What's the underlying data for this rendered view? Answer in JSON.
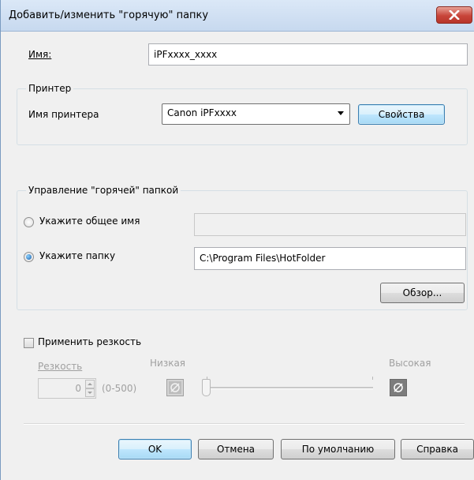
{
  "window": {
    "title": "Добавить/изменить \"горячую\" папку"
  },
  "name": {
    "label": "Имя:",
    "value": "iPFxxxx_xxxx"
  },
  "printer": {
    "group_label": "Принтер",
    "name_label": "Имя принтера",
    "selected": "Canon iPFxxxx",
    "properties_button": "Свойства"
  },
  "hotfolder": {
    "group_label": "Управление \"горячей\" папкой",
    "share_name_label": "Укажите общее имя",
    "share_name_value": "",
    "folder_label": "Укажите папку",
    "folder_value": "C:\\Program Files\\HotFolder",
    "browse_button": "Обзор...",
    "selected_option": "folder"
  },
  "sharpness": {
    "apply_label": "Применить резкость",
    "apply_checked": false,
    "level_label": "Резкость",
    "value": "0",
    "range": "(0-500)",
    "low_label": "Низкая",
    "high_label": "Высокая",
    "slider_position": 0
  },
  "buttons": {
    "ok": "OK",
    "cancel": "Отмена",
    "default": "По умолчанию",
    "help": "Справка"
  },
  "icons": [
    "close-icon",
    "chevron-down-icon",
    "spin-up-icon",
    "spin-down-icon",
    "sharpness-low-icon",
    "sharpness-high-icon"
  ]
}
